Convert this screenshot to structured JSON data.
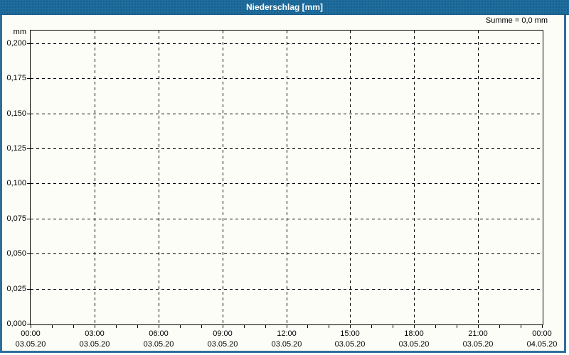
{
  "header": {
    "title": "Niederschlag [mm]"
  },
  "summary_label": "Summe = 0,0 mm",
  "colors": {
    "header_blue": "#1e6d9e",
    "frame_blue": "#2c6f9c",
    "axis_color": "#000000",
    "background": "#fdfdf8",
    "text": "#000000"
  },
  "chart_data": {
    "type": "line",
    "title": "Niederschlag [mm]",
    "ylabel": "mm",
    "summary": "Summe = 0,0 mm",
    "grid": "dashed",
    "ylim": [
      0,
      0.2095
    ],
    "xlim_hours": [
      0,
      24
    ],
    "y_ticks": [
      {
        "label": "0,200",
        "value": 0.2
      },
      {
        "label": "0,175",
        "value": 0.175
      },
      {
        "label": "0,150",
        "value": 0.15
      },
      {
        "label": "0,125",
        "value": 0.125
      },
      {
        "label": "0,100",
        "value": 0.1
      },
      {
        "label": "0,075",
        "value": 0.075
      },
      {
        "label": "0,050",
        "value": 0.05
      },
      {
        "label": "0,025",
        "value": 0.025
      },
      {
        "label": "0,000",
        "value": 0.0
      }
    ],
    "x_major_ticks": [
      {
        "hour": 0,
        "time": "00:00",
        "date": "03.05.20"
      },
      {
        "hour": 3,
        "time": "03:00",
        "date": "03.05.20"
      },
      {
        "hour": 6,
        "time": "06:00",
        "date": "03.05.20"
      },
      {
        "hour": 9,
        "time": "09:00",
        "date": "03.05.20"
      },
      {
        "hour": 12,
        "time": "12:00",
        "date": "03.05.20"
      },
      {
        "hour": 15,
        "time": "15:00",
        "date": "03.05.20"
      },
      {
        "hour": 18,
        "time": "18:00",
        "date": "03.05.20"
      },
      {
        "hour": 21,
        "time": "21:00",
        "date": "03.05.20"
      },
      {
        "hour": 24,
        "time": "00:00",
        "date": "04.05.20"
      }
    ],
    "x_minor_tick_interval_hours": 1,
    "series": [
      {
        "name": "Niederschlag",
        "values": []
      }
    ]
  }
}
